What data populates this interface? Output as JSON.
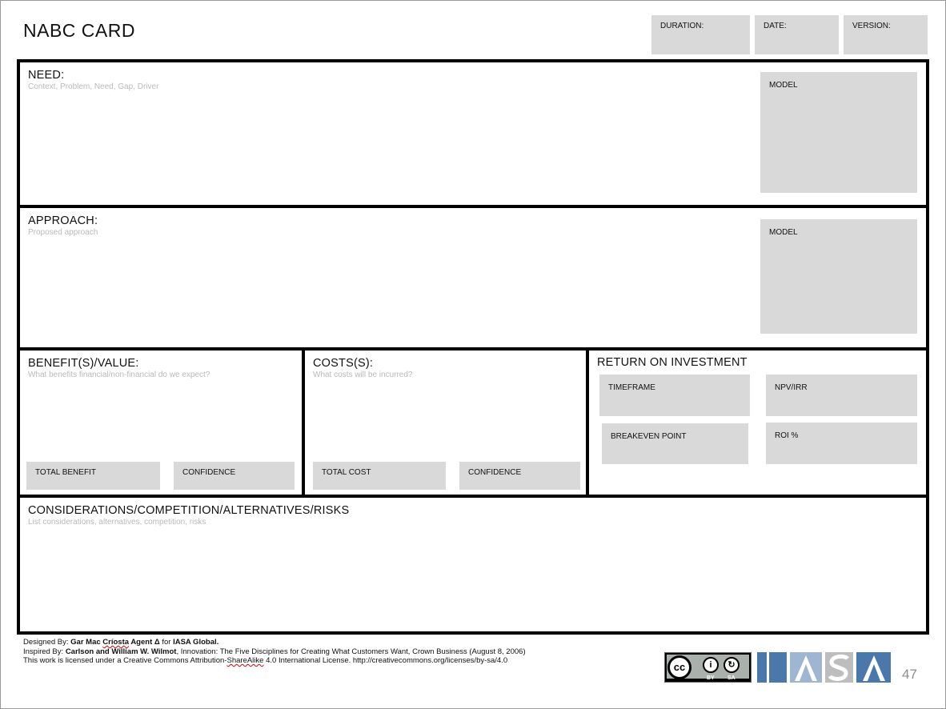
{
  "title": "NABC CARD",
  "meta": {
    "duration": "DURATION:",
    "date": "DATE:",
    "version": "VERSION:"
  },
  "need": {
    "title": "NEED:",
    "subtitle": "Context, Problem, Need, Gap, Driver",
    "model_label": "MODEL"
  },
  "approach": {
    "title": "APPROACH:",
    "subtitle": "Proposed approach",
    "model_label": "MODEL"
  },
  "benefit": {
    "title": "BENEFIT(S)/VALUE:",
    "subtitle": "What benefits financial/non-financial do we expect?",
    "total_label": "TOTAL BENEFIT",
    "confidence_label": "CONFIDENCE"
  },
  "costs": {
    "title": "COSTS(S):",
    "subtitle": "What costs will be incurred?",
    "total_label": "TOTAL COST",
    "confidence_label": "CONFIDENCE"
  },
  "roi": {
    "title": "RETURN ON INVESTMENT",
    "timeframe": "TIMEFRAME",
    "npv": "NPV/IRR",
    "breakeven": "BREAKEVEN POINT",
    "roi_pct": "ROI %"
  },
  "considerations": {
    "title": "CONSIDERATIONS/COMPETITION/ALTERNATIVES/RISKS",
    "subtitle": "List  considerations, alternatives, competition, risks"
  },
  "footer": {
    "designed_prefix": "Designed By: ",
    "designer_a": "Gar Mac ",
    "designer_b": "Críosta",
    "designer_c": " Agent Δ",
    "designed_for": " for ",
    "org": "IASA Global.",
    "inspired_prefix": "Inspired By: ",
    "inspired_authors": "Carlson and William W. Wilmot",
    "inspired_rest": ", Innovation: The Five Disciplines for Creating What Customers Want, Crown Business (August 8, 2006)",
    "license_a": "This work is licensed under a Creative Commons Attribution-",
    "license_b": "ShareAlike",
    "license_c": " 4.0 International License. http://creativecommons.org/licenses/by-sa/4.0"
  },
  "cc_badge": {
    "cc": "cc",
    "by": "BY",
    "sa": "SA",
    "person_glyph": "i",
    "sa_glyph": "↻"
  },
  "logo_text": "IASA",
  "logo_colors": [
    "#4a78ab",
    "#9fb6d2",
    "#bdbdbd",
    "#4a78ab"
  ],
  "page_number": "47"
}
